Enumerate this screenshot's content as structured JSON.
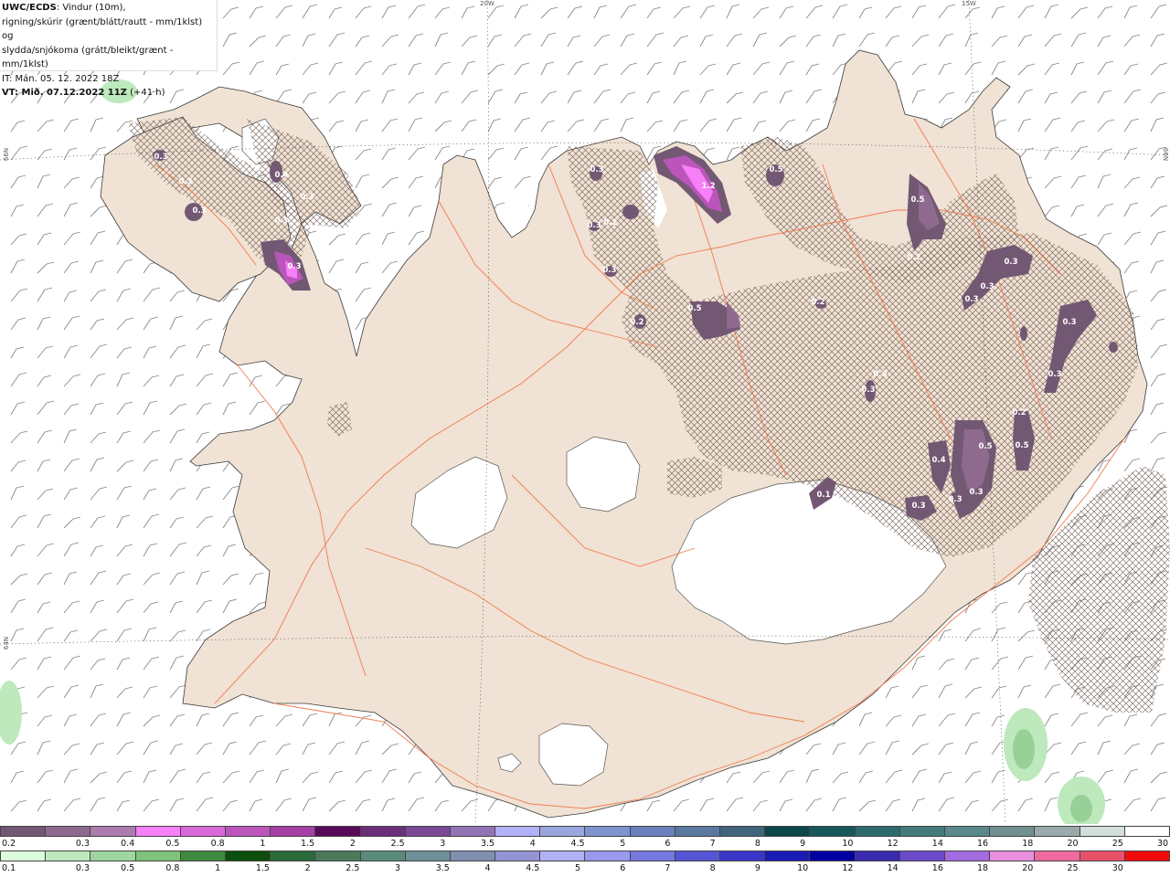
{
  "header": {
    "source": "UWC/ECDS",
    "line1_rest": ": Vindur (10m),",
    "line2": "rigning/skúrir (grænt/blátt/rautt - mm/1klst) og",
    "line3": "slydda/snjókoma (grátt/bleikt/grænt - mm/1klst)",
    "it_line": "IT: Mán. 05. 12. 2022 18Z",
    "vt_label": "VT: Mið. 07.12.2022 11Z",
    "vt_rest": " (+41 h)"
  },
  "grid_labels": {
    "lon_20w": "20W",
    "lon_15w": "15W",
    "lat_66n_left": "66N",
    "lat_66n_right": "66N",
    "lat_64n_left": "64N"
  },
  "map_labels": [
    "0.3",
    "0.3",
    "0.3",
    "0.4",
    "0.3",
    "0.3",
    "0.3",
    "0.3",
    "0.3",
    "0.2",
    "1.2",
    "0.5",
    "0.5",
    "0.3",
    "0.2",
    "0.5",
    "0.3",
    "0.3",
    "0.3",
    "0.2",
    "0.2",
    "0.4",
    "0.5",
    "0.5",
    "0.3",
    "0.1",
    "0.3",
    "0.3",
    "0.2",
    "0.3",
    "0.3",
    "0.3",
    "0.3"
  ],
  "legend_snow": {
    "colors": [
      "#735873",
      "#8e6a8e",
      "#ad7bad",
      "#f77ff7",
      "#d968d9",
      "#bb55bb",
      "#a63fa6",
      "#580a58",
      "#6b2f7a",
      "#7a4894",
      "#9273b5",
      "#b1b1f7",
      "#9aa7de",
      "#7f93cf",
      "#6a7fbd",
      "#5a79a1",
      "#40657c",
      "#0c4749",
      "#18585b",
      "#2d6b6d",
      "#447b7c",
      "#59898a",
      "#708f8f",
      "#9aa9a9",
      "#d2dfdd",
      "#ffffff"
    ],
    "ticks": [
      "0.2",
      "0.3",
      "0.4",
      "0.5",
      "0.8",
      "1",
      "1.5",
      "2",
      "2.5",
      "3",
      "3.5",
      "4",
      "4.5",
      "5",
      "6",
      "7",
      "8",
      "9",
      "10",
      "12",
      "14",
      "16",
      "18",
      "20",
      "25",
      "30"
    ]
  },
  "legend_rain": {
    "colors": [
      "#ddfcdd",
      "#bde9bd",
      "#9ed69e",
      "#7ec27e",
      "#3e8a3e",
      "#0c4e0c",
      "#2a6a3a",
      "#4a7a5a",
      "#5a8a7a",
      "#6f8f96",
      "#7f8fb0",
      "#9494d4",
      "#b1b1f7",
      "#9999ee",
      "#7777e0",
      "#5555d5",
      "#3838c8",
      "#1a1ab6",
      "#0000a0",
      "#3a2ab0",
      "#6a4ac8",
      "#a46ae0",
      "#e890e0",
      "#f06aa0",
      "#e8506a",
      "#f20a0a"
    ],
    "ticks": [
      "0.1",
      "0.3",
      "0.5",
      "0.8",
      "1",
      "1.5",
      "2",
      "2.5",
      "3",
      "3.5",
      "4",
      "4.5",
      "5",
      "6",
      "7",
      "8",
      "9",
      "10",
      "12",
      "14",
      "16",
      "18",
      "20",
      "25",
      "30"
    ]
  }
}
